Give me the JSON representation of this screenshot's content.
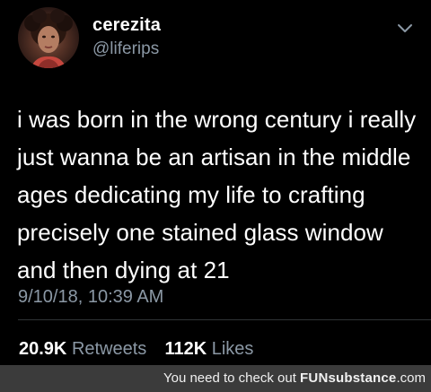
{
  "tweet": {
    "display_name": "cerezita",
    "handle": "@liferips",
    "text": "i was born in the wrong century i really just wanna be an artisan in the middle ages dedicating my life to crafting precisely one stained glass window and then dying at 21",
    "timestamp": "9/10/18, 10:39 AM",
    "retweets_count": "20.9K",
    "retweets_label": "Retweets",
    "likes_count": "112K",
    "likes_label": "Likes",
    "menu_icon": "chevron-down-icon",
    "avatar_icon": "avatar-photo"
  },
  "footer": {
    "prefix": "You need to check out ",
    "brand_fun": "FUN",
    "brand_rest": "substance",
    "brand_suffix": ".com"
  },
  "colors": {
    "background": "#000000",
    "text_primary": "#ffffff",
    "text_secondary": "#8b98a5",
    "divider": "#2f3336",
    "footer_bg": "#3b3b3b"
  }
}
